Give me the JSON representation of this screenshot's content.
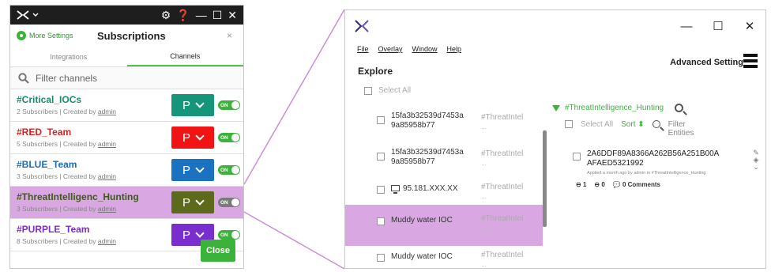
{
  "left_window": {
    "header": {
      "more_settings": "More Settings",
      "title": "Subscriptions",
      "close": "×"
    },
    "tabs": [
      {
        "label": "Integrations",
        "active": false
      },
      {
        "label": "Channels",
        "active": true
      }
    ],
    "filter_placeholder": "Filter channels",
    "channels": [
      {
        "name": "#Critical_IOCs",
        "subscribers": "2 Subscribers | Created by ",
        "creator": "admin",
        "name_color": "#1a8a6b",
        "p_color": "#15967a",
        "toggle": "ON"
      },
      {
        "name": "#RED_Team",
        "subscribers": "5 Subscribers | Created by ",
        "creator": "admin",
        "name_color": "#e01b1b",
        "p_color": "#f01414",
        "toggle": "ON"
      },
      {
        "name": "#BLUE_Team",
        "subscribers": "3 Subscribers | Created by ",
        "creator": "admin",
        "name_color": "#1b6fb0",
        "p_color": "#1b72c0",
        "toggle": "ON"
      },
      {
        "name": "#ThreatIntelligenc_Hunting",
        "subscribers": "3 Subscribers | Created by ",
        "creator": "admin",
        "name_color": "#3e5a1a",
        "p_color": "#5c6a1c",
        "toggle": "ON"
      },
      {
        "name": "#PURPLE_Team",
        "subscribers": "8 Subscribers | Created by ",
        "creator": "admin",
        "name_color": "#7b2ec0",
        "p_color": "#7a2ed0",
        "toggle": "ON"
      }
    ],
    "p_label": "P",
    "close_label": "Close"
  },
  "right_window": {
    "controls": {
      "minimize": "—",
      "maximize": "☐",
      "close": "✕"
    },
    "menu": [
      "File",
      "Overlay",
      "Window",
      "Help"
    ],
    "explore_title": "Explore",
    "advanced_settings": "Advanced Setting",
    "select_all": "Select All",
    "list": [
      {
        "text": "15fa3b32539d7453a 9a85958b77",
        "tag": "#ThreatIntel",
        "dots": "...",
        "icon": ""
      },
      {
        "text": "15fa3b32539d7453a 9a85958b77",
        "tag": "#ThreatIntel",
        "dots": "...",
        "icon": ""
      },
      {
        "text": "95.181.XXX.XX",
        "tag": "#ThreatIntel",
        "dots": "...",
        "icon": "monitor-icon"
      },
      {
        "text": "Muddy water IOC",
        "tag": "#ThreatIntel",
        "dots": "...",
        "icon": ""
      },
      {
        "text": "Muddy water IOC",
        "tag": "#ThreatIntel",
        "dots": "...",
        "icon": ""
      }
    ],
    "detail": {
      "channel": "#ThreatIntelligence_Hunting",
      "select_all": "Select All",
      "sort": "Sort",
      "filter": "Filter Entities",
      "entity_hash": "2A6DDF89A8366A262B56A251B00A AFAED5321992",
      "entity_meta": "Applied a month ago by admin in #ThreatIntelligence_Hunting",
      "stat1": "1",
      "stat2": "0",
      "comments": "0 Comments"
    }
  },
  "colors": {
    "highlight": "#d9a8e2",
    "green": "#3bb33b",
    "titlebar": "#1e1e1e"
  }
}
